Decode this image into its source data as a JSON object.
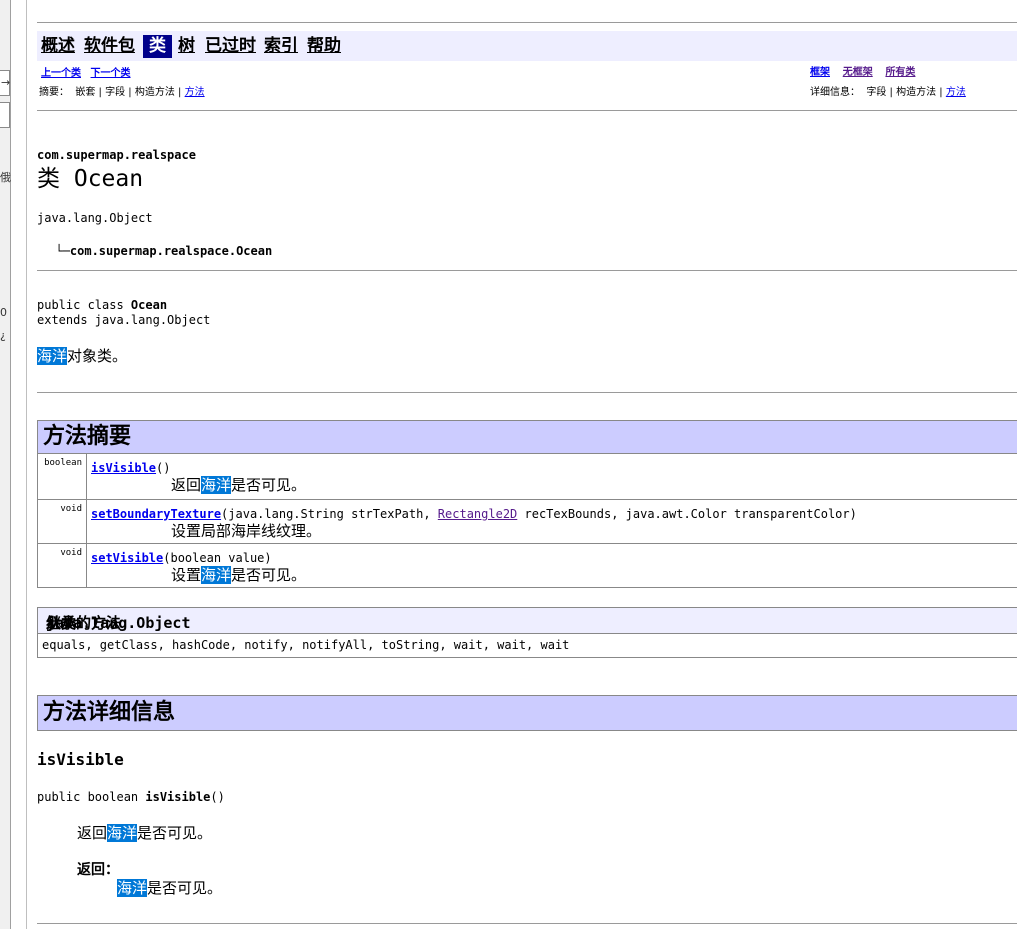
{
  "left_strip": {
    "glyphs": [
      "→",
      "俄",
      "0",
      "¿"
    ]
  },
  "nav": {
    "overview": "概述",
    "package": "软件包",
    "class": "类",
    "tree": "树",
    "deprecated": "已过时",
    "index": "索引",
    "help": "帮助"
  },
  "subnav": {
    "prev_class": "上一个类",
    "next_class": "下一个类",
    "frames": "框架",
    "no_frames": "无框架",
    "all_classes": "所有类",
    "summary_label": "摘要：",
    "summary_nested": "嵌套",
    "summary_field": "字段",
    "summary_ctor": "构造方法",
    "summary_method": "方法",
    "detail_label": "详细信息：",
    "detail_field": "字段",
    "detail_ctor": "构造方法",
    "detail_method": "方法",
    "sep": "|"
  },
  "class_info": {
    "package": "com.supermap.realspace",
    "title": "类 Ocean",
    "tree_root": "java.lang.Object",
    "tree_leaf": "com.supermap.realspace.Ocean",
    "decl_prefix": "public class ",
    "decl_name": "Ocean",
    "decl_extends": "extends java.lang.Object",
    "desc_hl": "海洋",
    "desc_rest": "对象类。"
  },
  "method_summary": {
    "heading": "方法摘要",
    "rows": [
      {
        "type": "boolean",
        "name": "isVisible",
        "params": "()",
        "desc_pre": "返回",
        "desc_hl": "海洋",
        "desc_post": "是否可见。"
      },
      {
        "type": "void",
        "name": "setBoundaryTexture",
        "params_a": "(java.lang.String strTexPath, ",
        "params_link": "Rectangle2D",
        "params_b": " recTexBounds, java.awt.Color transparentColor)",
        "desc_pre": "设置局部海岸线纹理。",
        "desc_hl": "",
        "desc_post": ""
      },
      {
        "type": "void",
        "name": "setVisible",
        "params": "(boolean value)",
        "desc_pre": "设置",
        "desc_hl": "海洋",
        "desc_post": "是否可见。"
      }
    ]
  },
  "inherited": {
    "heading_pre": "从类 ",
    "heading_class": "java.lang.Object",
    "heading_post": " 继承的方法",
    "methods": "equals, getClass, hashCode, notify, notifyAll, toString, wait, wait, wait"
  },
  "method_detail": {
    "heading": "方法详细信息",
    "name": "isVisible",
    "sig_prefix": "public boolean ",
    "sig_name": "isVisible",
    "sig_suffix": "()",
    "desc_pre": "返回",
    "desc_hl": "海洋",
    "desc_post": "是否可见。",
    "returns_label": "返回：",
    "returns_hl": "海洋",
    "returns_post": "是否可见。"
  }
}
